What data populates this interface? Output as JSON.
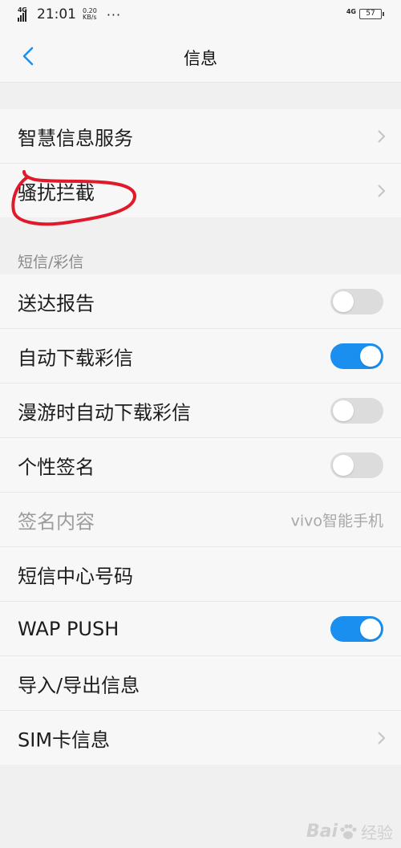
{
  "status_bar": {
    "network_left": "4G",
    "time": "21:01",
    "speed_value": "0.20",
    "speed_unit": "KB/s",
    "more": "···",
    "network_right": "4G",
    "battery": "57"
  },
  "header": {
    "title": "信息",
    "back_icon": "chevron-left-icon",
    "accent": "#1a8ff0"
  },
  "group1": {
    "items": [
      {
        "label": "智慧信息服务",
        "icon": "chevron-right-icon"
      },
      {
        "label": "骚扰拦截",
        "icon": "chevron-right-icon"
      }
    ]
  },
  "sms_section": {
    "title": "短信/彩信",
    "items": [
      {
        "label": "送达报告",
        "toggle": false
      },
      {
        "label": "自动下载彩信",
        "toggle": true
      },
      {
        "label": "漫游时自动下载彩信",
        "toggle": false
      },
      {
        "label": "个性签名",
        "toggle": false
      },
      {
        "label": "签名内容",
        "value": "vivo智能手机",
        "disabled": true
      },
      {
        "label": "短信中心号码"
      },
      {
        "label": "WAP PUSH",
        "toggle": true
      },
      {
        "label": "导入/导出信息"
      },
      {
        "label": "SIM卡信息",
        "icon": "chevron-right-icon"
      }
    ]
  },
  "annotation": {
    "color": "#e0192b"
  },
  "watermark": {
    "text": "Bai",
    "suffix": "经验"
  }
}
